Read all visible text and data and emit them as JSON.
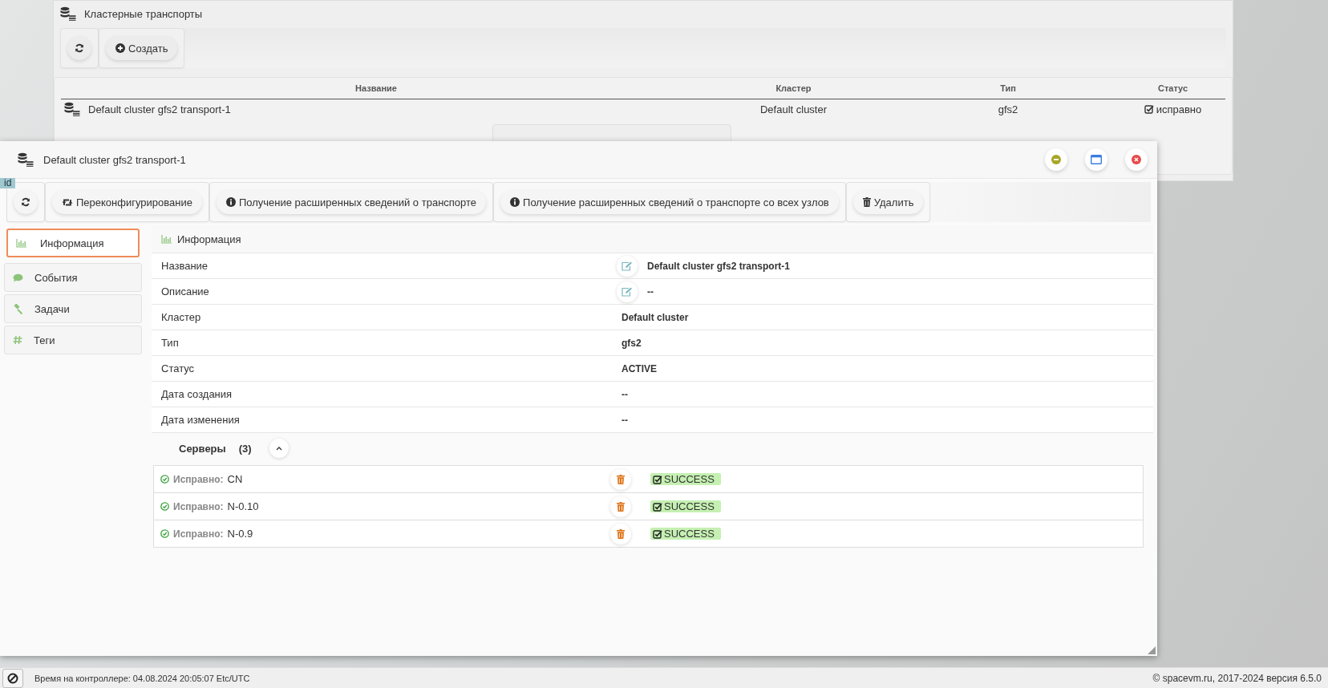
{
  "background_window": {
    "title": "Кластерные транспорты",
    "toolbar": [
      {
        "kind": "refresh"
      },
      {
        "kind": "create",
        "label": "Создать"
      }
    ],
    "table": {
      "columns": [
        "Название",
        "Кластер",
        "Тип",
        "Статус"
      ],
      "rows": [
        {
          "name": "Default cluster gfs2 transport-1",
          "cluster": "Default cluster",
          "type": "gfs2",
          "status": "исправно"
        }
      ]
    }
  },
  "dialog": {
    "title": "Default cluster gfs2 transport-1",
    "id_badge": "id",
    "toolbar": [
      {
        "kind": "refresh"
      },
      {
        "kind": "reconfigure",
        "label": "Переконфигурирование"
      },
      {
        "kind": "info",
        "label": "Получение расширенных сведений о транспорте"
      },
      {
        "kind": "info",
        "label": "Получение расширенных сведений о транспорте со всех узлов"
      },
      {
        "kind": "delete",
        "label": "Удалить"
      }
    ],
    "tabs": [
      {
        "label": "Информация",
        "kind": "info",
        "selected": true
      },
      {
        "label": "События",
        "kind": "events",
        "selected": false
      },
      {
        "label": "Задачи",
        "kind": "tasks",
        "selected": false
      },
      {
        "label": "Теги",
        "kind": "tags",
        "selected": false
      }
    ],
    "section_title": "Информация",
    "fields": [
      {
        "label": "Название",
        "value": "Default cluster gfs2 transport-1",
        "editable": true
      },
      {
        "label": "Описание",
        "value": "--",
        "editable": true
      },
      {
        "label": "Кластер",
        "value": "Default cluster",
        "editable": false
      },
      {
        "label": "Тип",
        "value": "gfs2",
        "editable": false
      },
      {
        "label": "Статус",
        "value": "ACTIVE",
        "editable": false
      },
      {
        "label": "Дата создания",
        "value": "--",
        "editable": false
      },
      {
        "label": "Дата изменения",
        "value": "--",
        "editable": false
      }
    ],
    "servers": {
      "title": "Серверы",
      "count": "(3)",
      "expanded": true,
      "rows": [
        {
          "health": "Исправно:",
          "name": "CN",
          "status": "SUCCESS"
        },
        {
          "health": "Исправно:",
          "name": "N-0.10",
          "status": "SUCCESS"
        },
        {
          "health": "Исправно:",
          "name": "N-0.9",
          "status": "SUCCESS"
        }
      ]
    }
  },
  "status_bar": {
    "controller_time": "Время на контроллере: 04.08.2024 20:05:07 Etc/UTC",
    "copyright": "© spacevm.ru, 2017-2024 версия 6.5.0"
  }
}
